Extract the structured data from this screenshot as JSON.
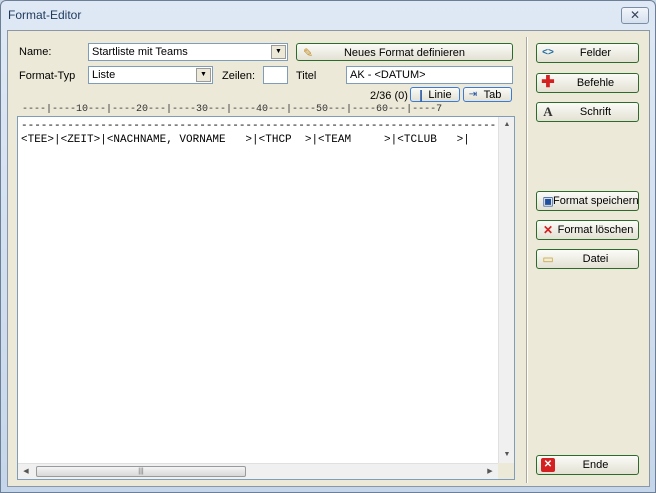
{
  "window": {
    "title": "Format-Editor",
    "close_label": "✕"
  },
  "form": {
    "name_label": "Name:",
    "name_value": "Startliste mit Teams",
    "type_label": "Format-Typ",
    "type_value": "Liste",
    "zeilen_label": "Zeilen:",
    "zeilen_value": "",
    "titel_label": "Titel",
    "titel_value": "AK - <DATUM>",
    "new_format_label": "Neues Format definieren",
    "position_text": "2/36 (0)",
    "linie_label": "Linie",
    "tab_label": "Tab"
  },
  "ruler": "----|----10---|----20---|----30---|----40---|----50---|----60---|----7",
  "editor": {
    "lines": [
      "------------------------------------------------------------------------",
      "<TEE>|<ZEIT>|<NACHNAME, VORNAME   >|<THCP  >|<TEAM     >|<TCLUB   >|"
    ]
  },
  "sidebar": {
    "felder": "Felder",
    "befehle": "Befehle",
    "schrift": "Schrift",
    "format_speichern": "Format speichern",
    "format_loeschen": "Format löschen",
    "datei": "Datei",
    "ende": "Ende"
  },
  "icons": {
    "felder": "code-brackets-icon",
    "befehle": "plus-icon",
    "schrift": "font-icon",
    "format_speichern": "save-icon",
    "format_loeschen": "delete-icon",
    "datei": "folder-icon",
    "ende": "exit-icon",
    "new_format": "pencil-icon"
  },
  "colors": {
    "button_border": "#2c6b2c",
    "accent_red": "#d42020",
    "accent_blue": "#1e4fa0"
  }
}
